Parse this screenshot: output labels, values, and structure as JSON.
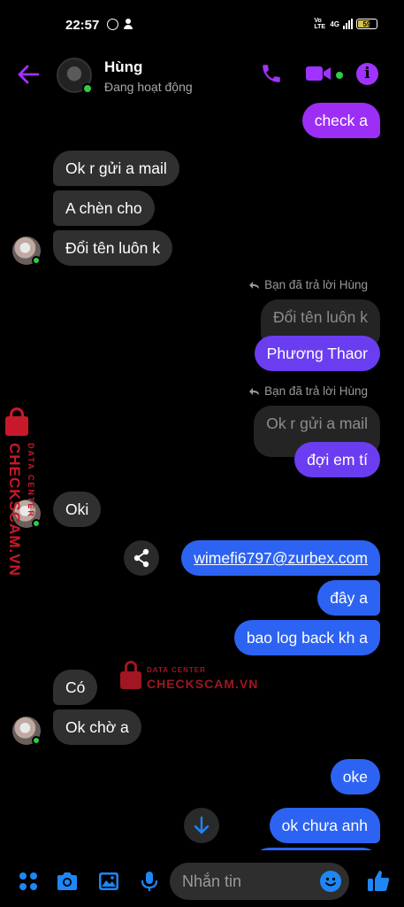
{
  "status_bar": {
    "time": "22:57",
    "network": "4G",
    "volte": "Vo LTE",
    "battery": "59"
  },
  "header": {
    "name": "Hùng",
    "status": "Đang hoạt động"
  },
  "messages": {
    "m1": "check a",
    "m2": "Ok r gửi a mail",
    "m3": "A chèn cho",
    "m4": "Đổi tên luôn k",
    "reply1_label": "Bạn đã trả lời Hùng",
    "reply1_quote": "Đổi tên luôn k",
    "m5": "Phương Thaor",
    "reply2_label": "Bạn đã trả lời Hùng",
    "reply2_quote": "Ok r gửi a mail",
    "m6": "đợi em tí",
    "m7": "Oki",
    "m8": "wimefi6797@zurbex.com",
    "m9": "đây a",
    "m10": "bao log back kh a",
    "m11": "Có",
    "m12": "Ok chờ a",
    "m13": "oke",
    "m14": "ok chưa anh"
  },
  "watermark": {
    "main": "CHECKSCAM.VN",
    "sub": "DATA CENTER"
  },
  "composer": {
    "placeholder": "Nhắn tin"
  },
  "colors": {
    "accent": "#a033ff",
    "bubble_purple": "#9c2ef5",
    "bubble_violet": "#6b3df0",
    "bubble_blue": "#2c63f2",
    "bubble_incoming": "#303030",
    "online": "#31cc46",
    "composer_blue": "#1e86f5",
    "watermark": "#c8192b"
  }
}
